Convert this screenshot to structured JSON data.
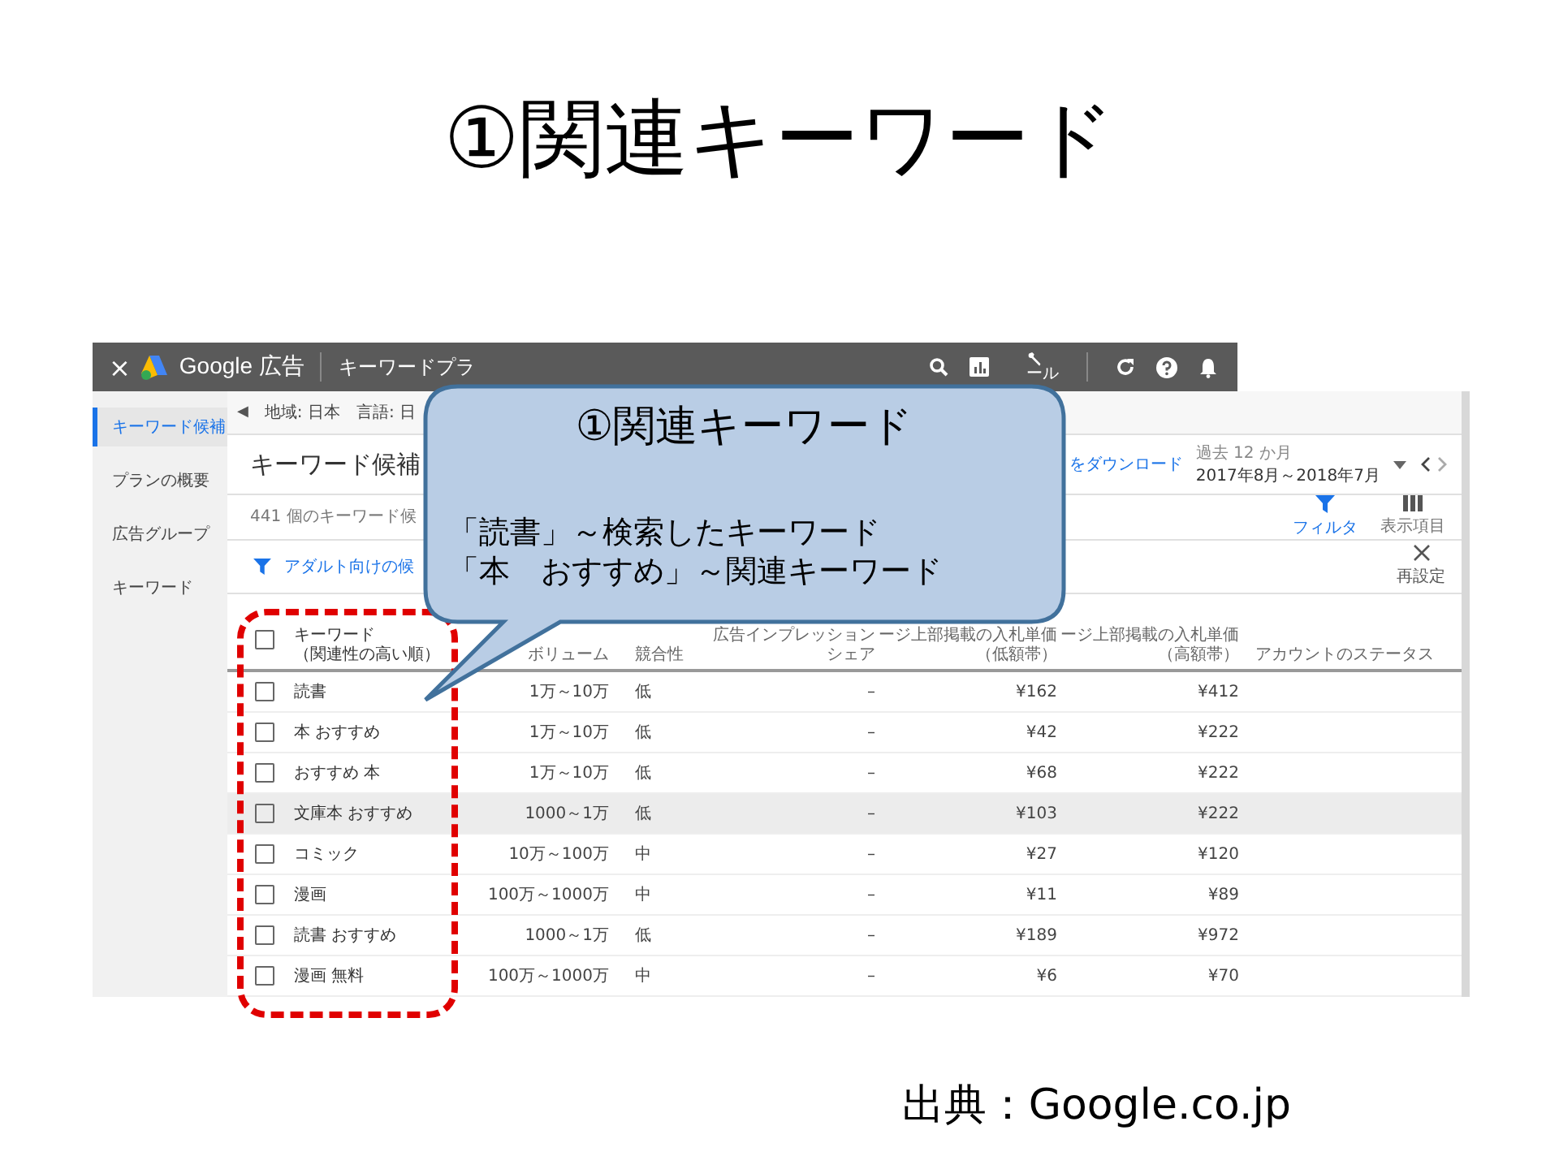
{
  "slide_title": "①関連キーワード",
  "app": {
    "close": "×",
    "brand": "Google 広告",
    "page": "キーワードプラ",
    "tool_label": "ール"
  },
  "sidebar": {
    "items": [
      {
        "label": "キーワード候補",
        "selected": true
      },
      {
        "label": "プランの概要",
        "selected": false
      },
      {
        "label": "広告グループ",
        "selected": false
      },
      {
        "label": "キーワード",
        "selected": false
      }
    ]
  },
  "collapse_button": "◀",
  "targeting": [
    "地域: 日本",
    "言語: 日"
  ],
  "heading": "キーワード候補",
  "download_link": "をダウンロード",
  "date_range": {
    "caption": "過去 12 か月",
    "value": "2017年8月～2018年7月"
  },
  "result_count": "441 個のキーワード候",
  "tools": [
    {
      "kind": "filter",
      "label": "フィルタ",
      "active": true
    },
    {
      "kind": "columns",
      "label": "表示項目",
      "active": false
    }
  ],
  "filter_chip": "アダルト向けの候",
  "reset": "再設定",
  "table": {
    "select_all_checked": false,
    "columns": [
      {
        "label": "キーワード",
        "sublabel": "（関連性の高い順）"
      },
      {
        "label": "ボリューム"
      },
      {
        "label": "競合性"
      },
      {
        "label": "広告インプレッション",
        "sublabel": "シェア"
      },
      {
        "label": "ージ上部掲載の入札単価",
        "sublabel": "（低額帯）"
      },
      {
        "label": "ージ上部掲載の入札単価",
        "sublabel": "（高額帯）"
      },
      {
        "label": "アカウントのステータス"
      }
    ],
    "rows": [
      {
        "checked": false,
        "keyword": "読書",
        "volume": "1万～10万",
        "competition": "低",
        "share": "–",
        "bid_low": "¥162",
        "bid_high": "¥412",
        "highlighted": false
      },
      {
        "checked": false,
        "keyword": "本 おすすめ",
        "volume": "1万～10万",
        "competition": "低",
        "share": "–",
        "bid_low": "¥42",
        "bid_high": "¥222",
        "highlighted": false
      },
      {
        "checked": false,
        "keyword": "おすすめ 本",
        "volume": "1万～10万",
        "competition": "低",
        "share": "–",
        "bid_low": "¥68",
        "bid_high": "¥222",
        "highlighted": false
      },
      {
        "checked": false,
        "keyword": "文庫本 おすすめ",
        "volume": "1000～1万",
        "competition": "低",
        "share": "–",
        "bid_low": "¥103",
        "bid_high": "¥222",
        "highlighted": true
      },
      {
        "checked": false,
        "keyword": "コミック",
        "volume": "10万～100万",
        "competition": "中",
        "share": "–",
        "bid_low": "¥27",
        "bid_high": "¥120",
        "highlighted": false
      },
      {
        "checked": false,
        "keyword": "漫画",
        "volume": "100万～1000万",
        "competition": "中",
        "share": "–",
        "bid_low": "¥11",
        "bid_high": "¥89",
        "highlighted": false
      },
      {
        "checked": false,
        "keyword": "読書 おすすめ",
        "volume": "1000～1万",
        "competition": "低",
        "share": "–",
        "bid_low": "¥189",
        "bid_high": "¥972",
        "highlighted": false
      },
      {
        "checked": false,
        "keyword": "漫画 無料",
        "volume": "100万～1000万",
        "competition": "中",
        "share": "–",
        "bid_low": "¥6",
        "bid_high": "¥70",
        "highlighted": false
      }
    ]
  },
  "callout": {
    "title": "①関連キーワード",
    "lines": [
      "「読書」～検索したキーワード",
      "「本　おすすめ」～関連キーワード"
    ]
  },
  "source": "出典：Google.co.jp"
}
